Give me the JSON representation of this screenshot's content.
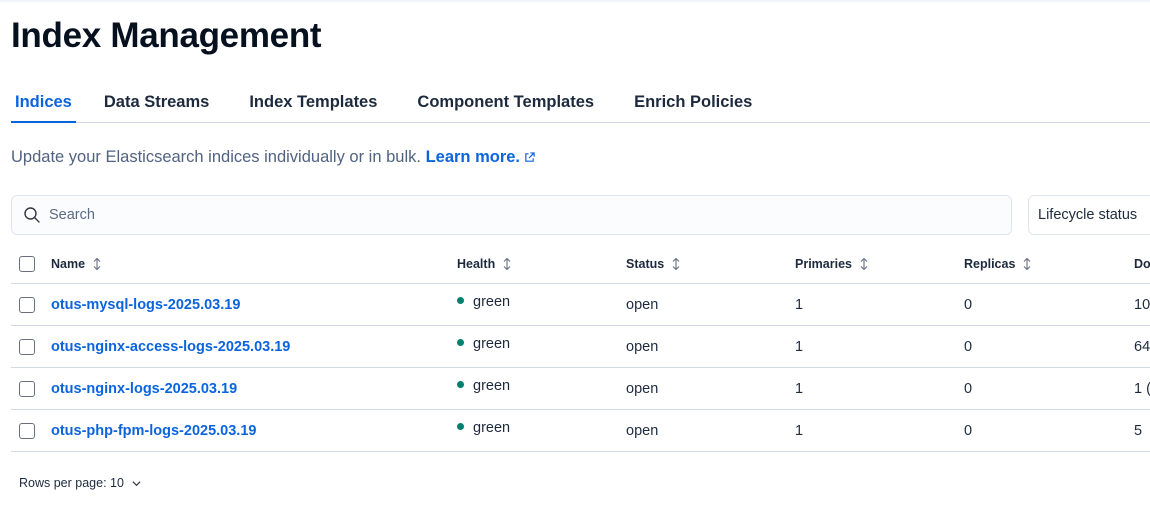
{
  "page": {
    "title": "Index Management"
  },
  "tabs": [
    {
      "label": "Indices",
      "selected": true
    },
    {
      "label": "Data Streams",
      "selected": false
    },
    {
      "label": "Index Templates",
      "selected": false
    },
    {
      "label": "Component Templates",
      "selected": false
    },
    {
      "label": "Enrich Policies",
      "selected": false
    }
  ],
  "description": {
    "text": "Update your Elasticsearch indices individually or in bulk.",
    "link_label": "Learn more.",
    "link_icon": "external-link-icon"
  },
  "search": {
    "placeholder": "Search",
    "value": "",
    "icon": "search-icon"
  },
  "filters": {
    "lifecycle_label": "Lifecycle status"
  },
  "table": {
    "columns": {
      "name": "Name",
      "health": "Health",
      "status": "Status",
      "primaries": "Primaries",
      "replicas": "Replicas",
      "docs": "Do"
    },
    "rows": [
      {
        "name": "otus-mysql-logs-2025.03.19",
        "health": "green",
        "status": "open",
        "primaries": "1",
        "replicas": "0",
        "docs": "10"
      },
      {
        "name": "otus-nginx-access-logs-2025.03.19",
        "health": "green",
        "status": "open",
        "primaries": "1",
        "replicas": "0",
        "docs": "64"
      },
      {
        "name": "otus-nginx-logs-2025.03.19",
        "health": "green",
        "status": "open",
        "primaries": "1",
        "replicas": "0",
        "docs": "1 ("
      },
      {
        "name": "otus-php-fpm-logs-2025.03.19",
        "health": "green",
        "status": "open",
        "primaries": "1",
        "replicas": "0",
        "docs": "5"
      }
    ]
  },
  "pagination": {
    "rows_per_page_label": "Rows per page: 10"
  },
  "colors": {
    "accent": "#0b64dd",
    "health_green": "#00806e",
    "text": "#1d2a3e",
    "border": "#d3dae6"
  }
}
